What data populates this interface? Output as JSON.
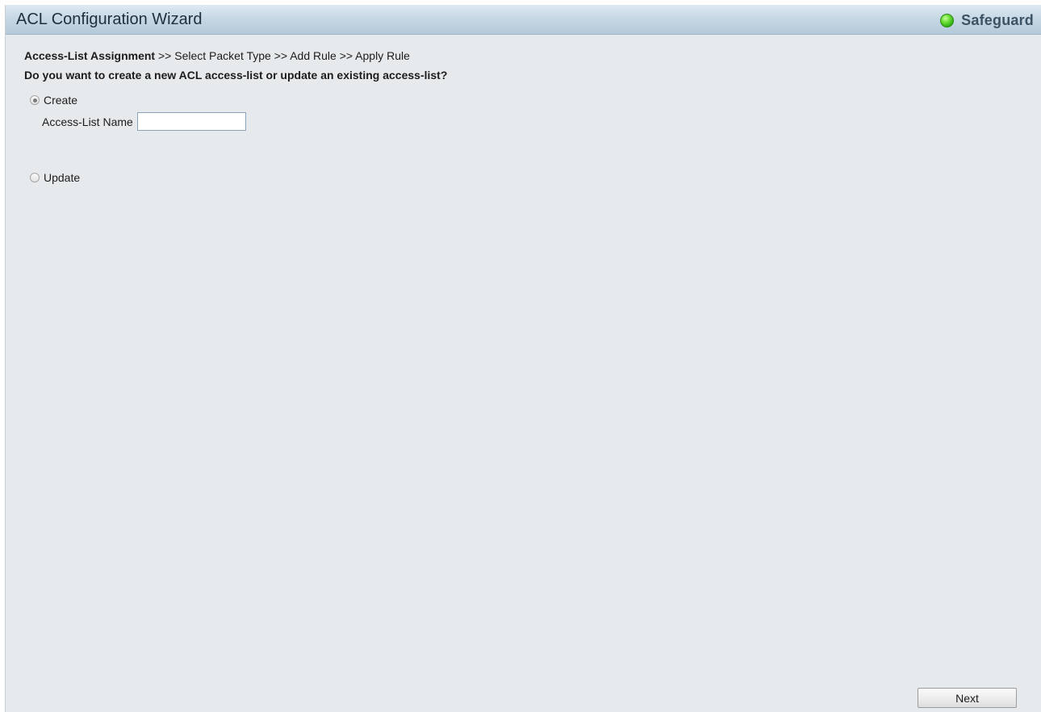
{
  "header": {
    "title": "ACL Configuration Wizard",
    "safeguard_label": "Safeguard",
    "safeguard_icon": "status-dot-icon",
    "safeguard_color": "#3cc41f"
  },
  "breadcrumb": {
    "current": "Access-List Assignment",
    "separator_1": ">>",
    "step_2": "Select Packet Type",
    "separator_2": ">>",
    "step_3": "Add Rule",
    "separator_3": ">>",
    "step_4": "Apply Rule"
  },
  "question": "Do you want to create a new ACL access-list or update an existing access-list?",
  "options": {
    "create": {
      "label": "Create",
      "selected": true
    },
    "update": {
      "label": "Update",
      "selected": false
    }
  },
  "access_list_name": {
    "label": "Access-List Name",
    "value": "",
    "placeholder": ""
  },
  "buttons": {
    "next": "Next"
  }
}
